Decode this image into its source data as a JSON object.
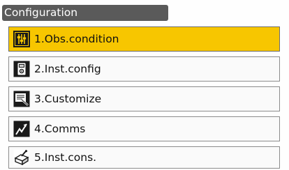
{
  "screen": {
    "title": "Configuration"
  },
  "menu": {
    "items": [
      {
        "label": "1.Obs.condition",
        "icon": "obs-condition-icon",
        "selected": true
      },
      {
        "label": "2.Inst.config",
        "icon": "instrument-config-icon",
        "selected": false
      },
      {
        "label": "3.Customize",
        "icon": "customize-icon",
        "selected": false
      },
      {
        "label": "4.Comms",
        "icon": "comms-icon",
        "selected": false
      },
      {
        "label": "5.Inst.cons.",
        "icon": "instrument-constants-icon",
        "selected": false
      }
    ]
  },
  "colors": {
    "title_bar": "#5a5a5a",
    "selected_bg": "#f7c600",
    "item_bg": "#fafafa",
    "border": "#8c8c8c"
  }
}
